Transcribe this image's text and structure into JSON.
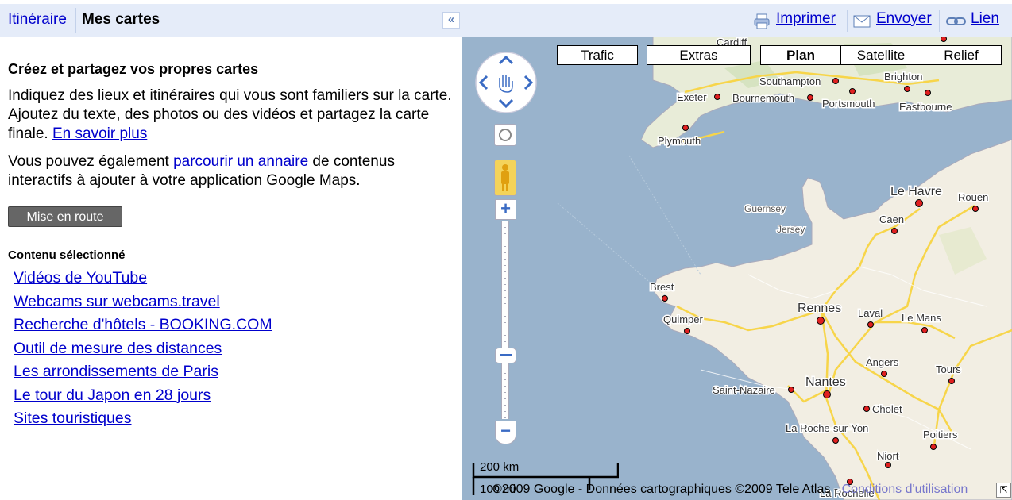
{
  "left_panel": {
    "tabs": {
      "itineraire": "Itinéraire",
      "mes_cartes": "Mes cartes"
    },
    "collapse_icon": "«",
    "heading": "Créez et partagez vos propres cartes",
    "para1_text": "Indiquez des lieux et itinéraires qui vous sont familiers sur la carte. Ajoutez du texte, des photos ou des vidéos et partagez la carte finale.",
    "para1_link": "En savoir plus",
    "para2_pre": "Vous pouvez également ",
    "para2_link": "parcourir un annaire",
    "para2_post": " de contenus interactifs à ajouter à votre application Google Maps.",
    "start_button": "Mise en route",
    "selected_title": "Contenu sélectionné",
    "selected_items": [
      "Vidéos de YouTube",
      "Webcams sur webcams.travel",
      "Recherche d'hôtels - BOOKING.COM",
      "Outil de mesure des distances",
      "Les arrondissements de Paris",
      "Le tour du Japon en 28 jours",
      "Sites touristiques"
    ]
  },
  "toolbar": {
    "print": "Imprimer",
    "send": "Envoyer",
    "link": "Lien",
    "icons": [
      "printer-icon",
      "envelope-icon",
      "chain-link-icon"
    ]
  },
  "map": {
    "types": {
      "trafic": "Trafic",
      "extras": "Extras",
      "plan": "Plan",
      "satellite": "Satellite",
      "relief": "Relief"
    },
    "active_type": "Plan",
    "zoom_in": "+",
    "zoom_out": "−",
    "scale_top": "200 km",
    "scale_bottom": "100 mi",
    "copyright": "©2009 Google - Données cartographiques ©2009 Tele Atlas - ",
    "terms_link": "Conditions d'utilisation",
    "cities": {
      "cardiff": "Cardiff",
      "southampton": "Southampton",
      "brighton": "Brighton",
      "exeter": "Exeter",
      "bournemouth": "Bournemouth",
      "portsmouth": "Portsmouth",
      "eastbourne": "Eastbourne",
      "plymouth": "Plymouth",
      "le_havre": "Le Havre",
      "rouen": "Rouen",
      "guernsey": "Guernsey",
      "jersey": "Jersey",
      "caen": "Caen",
      "brest": "Brest",
      "quimper": "Quimper",
      "rennes": "Rennes",
      "laval": "Laval",
      "le_mans": "Le Mans",
      "angers": "Angers",
      "tours": "Tours",
      "saint_nazaire": "Saint-Nazaire",
      "nantes": "Nantes",
      "cholet": "Cholet",
      "la_roche": "La Roche-sur-Yon",
      "poitiers": "Poitiers",
      "niort": "Niort",
      "la_rochelle": "La Rochelle"
    },
    "colors": {
      "sea": "#99b3cc",
      "land": "#f2eee3",
      "uk_land": "#e8ecd8",
      "road": "#f7d54a"
    }
  }
}
